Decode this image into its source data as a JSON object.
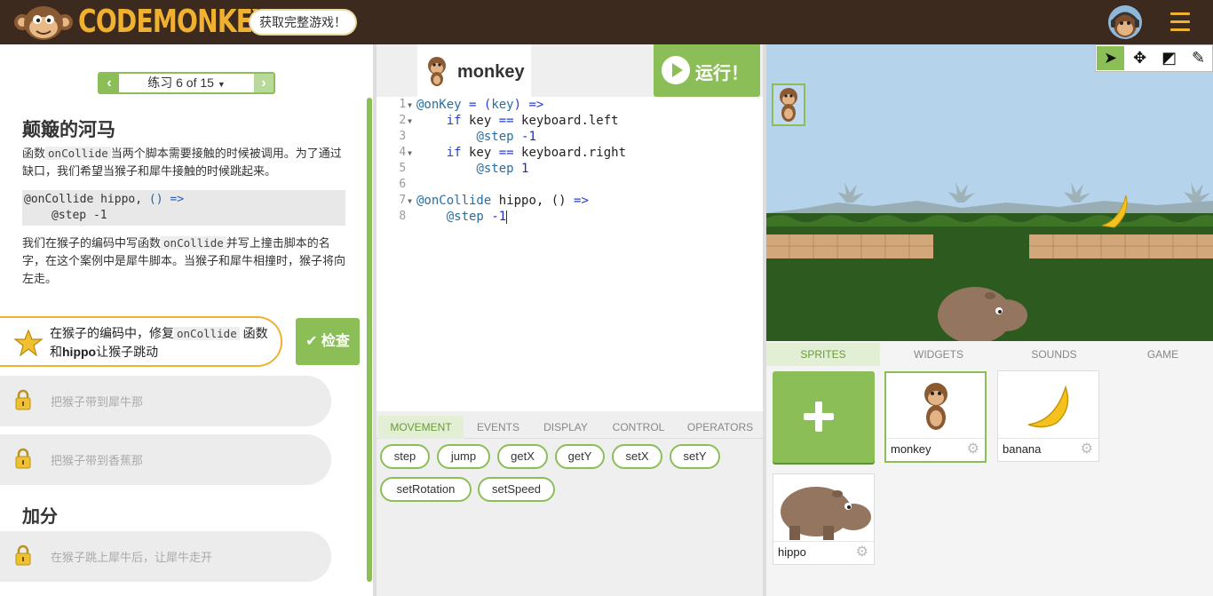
{
  "header": {
    "logo_text": "CodeMonkey",
    "promo_label": "获取完整游戏！"
  },
  "lesson": {
    "pager_label": "练习 6 of 15",
    "title": "颠簸的河马",
    "para1_a": "函数",
    "para1_code": "onCollide",
    "para1_b": "当两个脚本需要接触的时候被调用。为了通过缺口，我们希望当猴子和犀牛接触的时候跳起来。",
    "code_line1_a": "@onCollide hippo, ",
    "code_line1_b": "() =>",
    "code_line2": "@step -1",
    "para2_a": "我们在猴子的编码中写函数",
    "para2_code": "onCollide",
    "para2_b": "并写上撞击脚本的名字，在这个案例中是犀牛脚本。当猴子和犀牛相撞时，猴子将向左走。",
    "task_a": "在猴子的编码中，修复",
    "task_code": "onCollide",
    "task_b": "函数",
    "task_c": "和",
    "task_bold": "hippo",
    "task_d": "让猴子跳动",
    "check_label": "检查",
    "locked1": "把猴子带到犀牛那",
    "locked2": "把猴子带到香蕉那",
    "bonus_title": "加分",
    "locked3": "在猴子跳上犀牛后，让犀牛走开"
  },
  "editor": {
    "sprite_name": "monkey",
    "run_label": "运行！",
    "line_numbers": [
      "1",
      "2",
      "3",
      "4",
      "5",
      "6",
      "7",
      "8"
    ]
  },
  "palette": {
    "tabs": [
      "MOVEMENT",
      "EVENTS",
      "DISPLAY",
      "CONTROL",
      "OPERATORS"
    ],
    "blocks": [
      "step",
      "jump",
      "getX",
      "getY",
      "setX",
      "setY",
      "setRotation",
      "setSpeed"
    ]
  },
  "right_tabs": [
    "SPRITES",
    "WIDGETS",
    "SOUNDS",
    "GAME"
  ],
  "sprites": [
    "monkey",
    "banana",
    "hippo"
  ],
  "colors": {
    "brand_green": "#8cbe58",
    "brand_orange": "#f0b030",
    "topbar": "#3c2a1f"
  },
  "icons": [
    "play-icon",
    "check-icon",
    "star-icon",
    "lock-icon",
    "gear-icon",
    "arrow-pointer-icon",
    "move-icon",
    "eraser-icon",
    "brush-icon",
    "menu-icon"
  ]
}
